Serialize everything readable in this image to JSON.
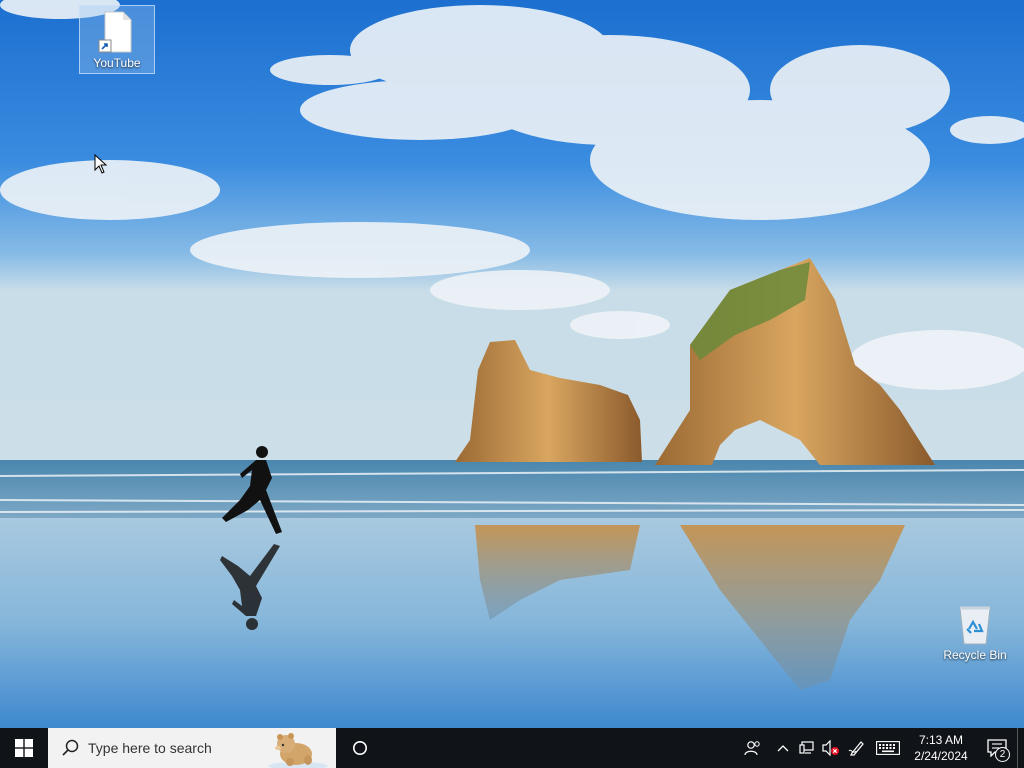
{
  "desktop": {
    "icons": [
      {
        "label": "YouTube",
        "type": "shortcut",
        "selected": true
      },
      {
        "label": "Recycle Bin",
        "type": "recycle-bin",
        "selected": false
      }
    ]
  },
  "taskbar": {
    "search_placeholder": "Type here to search",
    "clock": {
      "time": "7:13 AM",
      "date": "2/24/2024"
    },
    "notification_count": "2",
    "tray_icons": [
      "people-icon",
      "chevron-up-icon",
      "network-icon",
      "volume-muted-icon",
      "pen-icon",
      "keyboard-icon"
    ]
  },
  "colors": {
    "taskbar": "#101418",
    "search_box": "#f2f2f2",
    "start_logo": "#ffffff"
  }
}
